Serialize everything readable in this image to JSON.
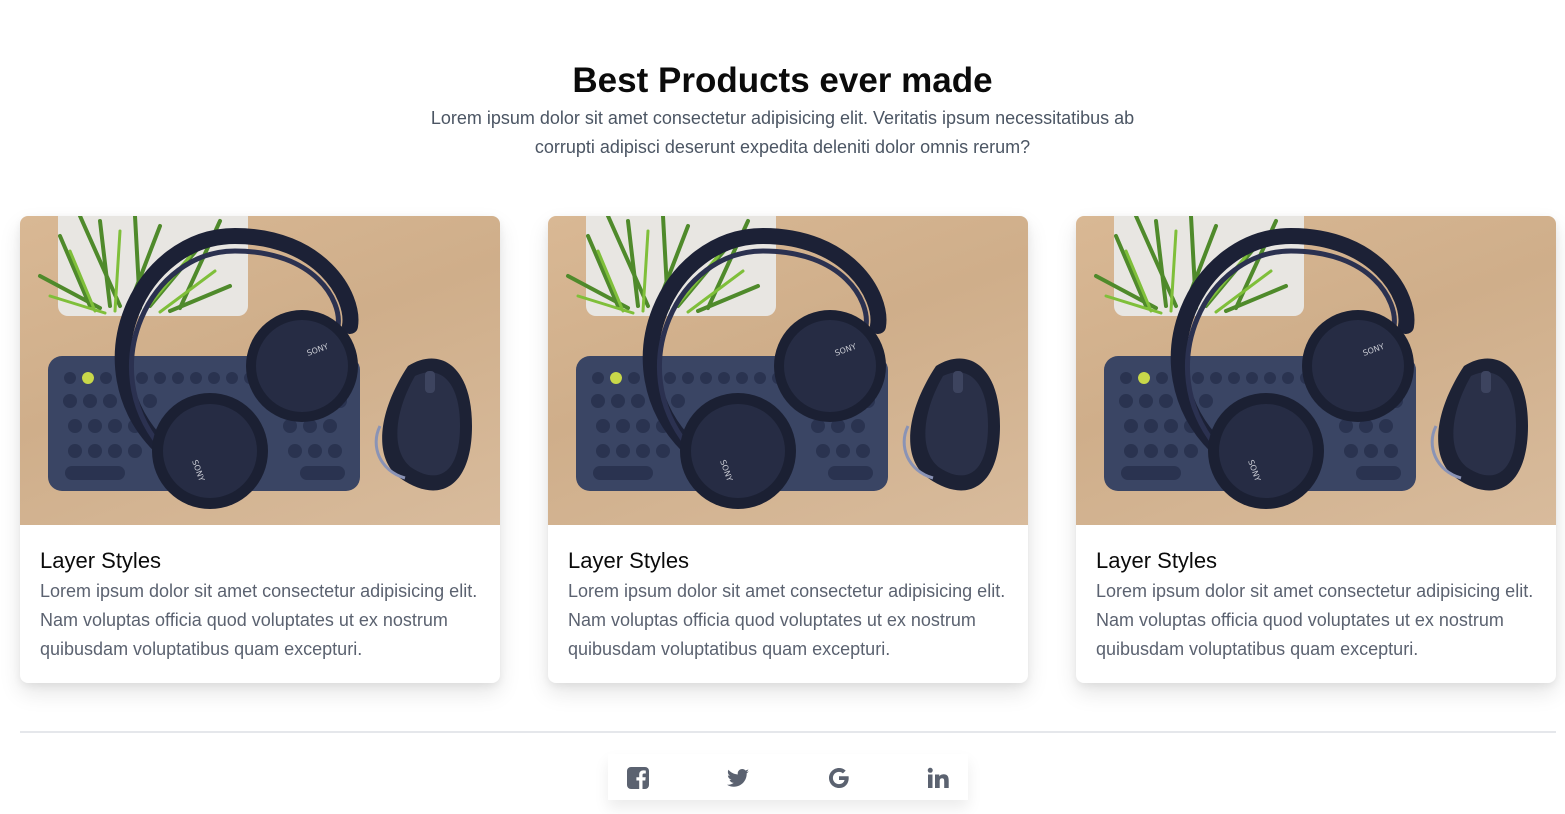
{
  "header": {
    "title": "Best Products ever made",
    "subtitle": "Lorem ipsum dolor sit amet consectetur adipisicing elit. Veritatis ipsum necessitatibus ab corrupti adipisci deserunt expedita deleniti dolor omnis rerum?"
  },
  "cards": [
    {
      "image": "headphones-keyboard-mouse-photo",
      "title": "Layer Styles",
      "text": "Lorem ipsum dolor sit amet consectetur adipisicing elit. Nam voluptas officia quod voluptates ut ex nostrum quibusdam voluptatibus quam excepturi."
    },
    {
      "image": "headphones-keyboard-mouse-photo",
      "title": "Layer Styles",
      "text": "Lorem ipsum dolor sit amet consectetur adipisicing elit. Nam voluptas officia quod voluptates ut ex nostrum quibusdam voluptatibus quam excepturi."
    },
    {
      "image": "headphones-keyboard-mouse-photo",
      "title": "Layer Styles",
      "text": "Lorem ipsum dolor sit amet consectetur adipisicing elit. Nam voluptas officia quod voluptates ut ex nostrum quibusdam voluptatibus quam excepturi."
    }
  ],
  "social": {
    "icons": [
      "facebook-icon",
      "twitter-icon",
      "google-icon",
      "linkedin-icon"
    ],
    "icon_color": "#5b6270"
  },
  "colors": {
    "title": "#0b0b0b",
    "body_text": "#5b6270",
    "divider": "#e5e7eb"
  }
}
